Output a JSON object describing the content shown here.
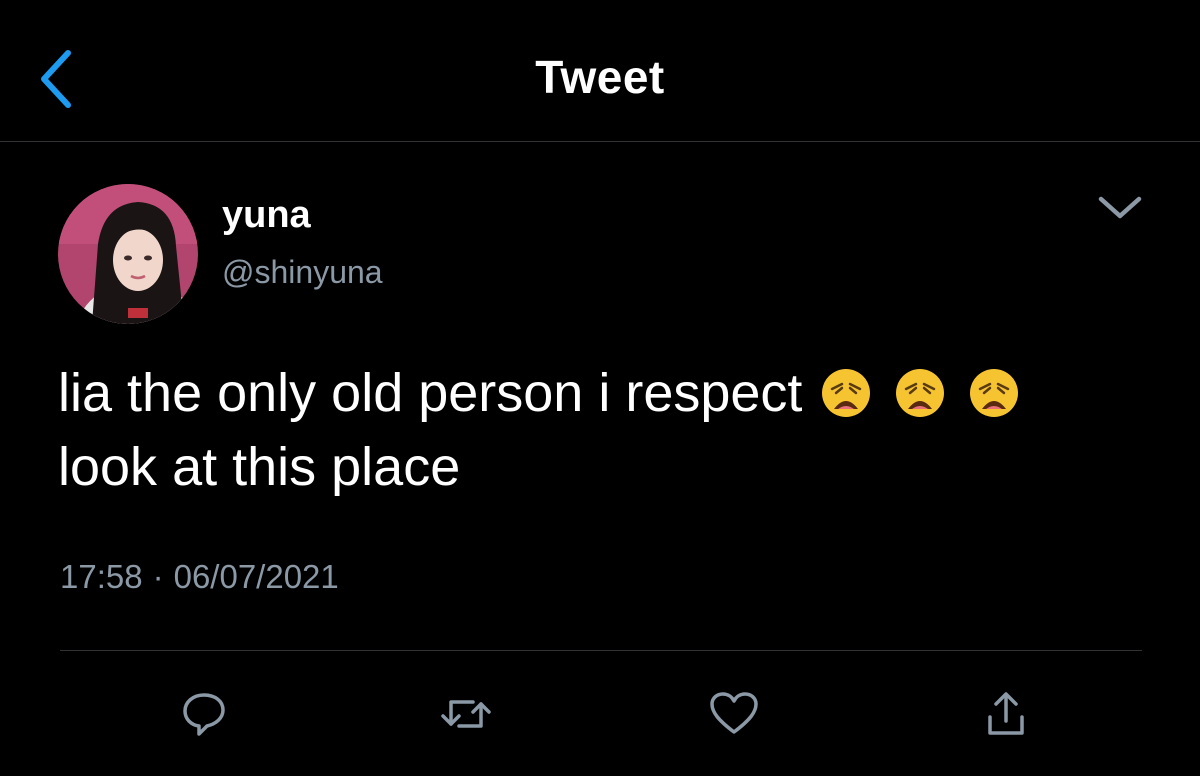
{
  "header": {
    "title": "Tweet",
    "back_icon": "chevron-left-icon"
  },
  "tweet": {
    "display_name": "yuna",
    "handle": "@shinyuna",
    "text_line1": "lia the only old person i respect",
    "text_line2": "look at this place",
    "emojis": [
      "weary-face",
      "weary-face",
      "weary-face"
    ],
    "time": "17:58",
    "separator": "·",
    "date": "06/07/2021"
  },
  "actions": [
    {
      "name": "reply",
      "icon": "reply-icon"
    },
    {
      "name": "retweet",
      "icon": "retweet-icon"
    },
    {
      "name": "like",
      "icon": "heart-icon"
    },
    {
      "name": "share",
      "icon": "share-icon"
    }
  ],
  "colors": {
    "background": "#000000",
    "accent": "#1d9bf0",
    "secondary_text": "#8b98a5",
    "divider": "#2f3336"
  }
}
